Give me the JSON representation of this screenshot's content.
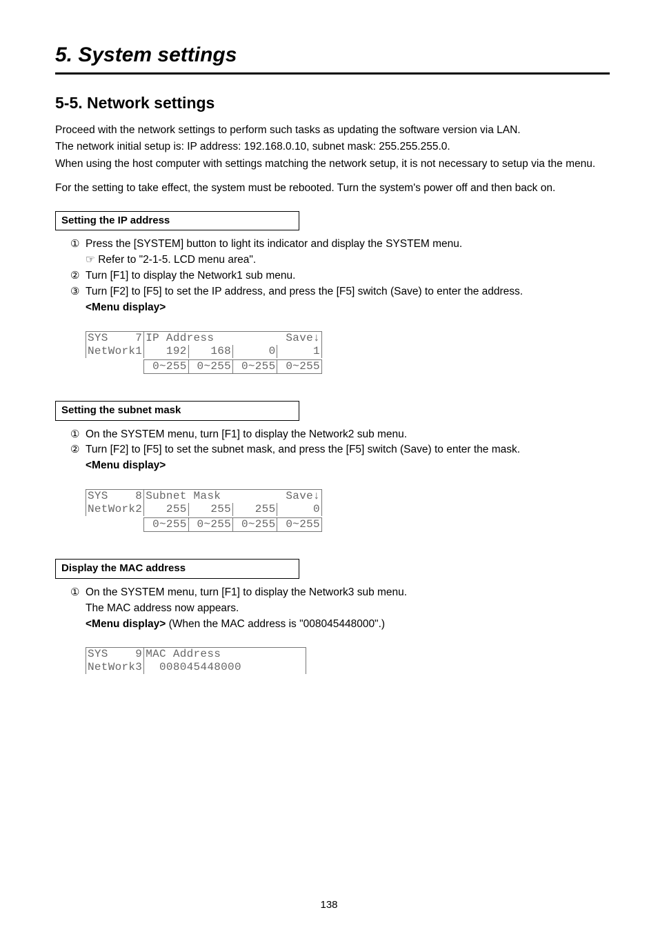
{
  "chapter": {
    "title": "5. System settings"
  },
  "section": {
    "title": "5-5. Network settings"
  },
  "intro": {
    "p1": "Proceed with the network settings to perform such tasks as updating the software version via LAN.",
    "p2": "The network initial setup is: IP address: 192.168.0.10, subnet mask: 255.255.255.0.",
    "p3": "When using the host computer with settings matching the network setup, it is not necessary to setup via the menu.",
    "p4": "For the setting to take effect, the system must be rebooted. Turn the system's power off and then back on."
  },
  "ip": {
    "heading": "Setting the IP address",
    "steps": {
      "s1": "Press the [SYSTEM] button to light its indicator and display the SYSTEM menu.",
      "s1_ref_icon": "☞",
      "s1_ref": " Refer to \"2-1-5. LCD menu area\".",
      "s2": "Turn [F1] to display the Network1 sub menu.",
      "s3": "Turn [F2] to [F5] to set the IP address, and press the [F5] switch (Save) to enter the address."
    },
    "menu_label": "<Menu display>",
    "lcd": {
      "r1c1": "SYS    7",
      "r1c2": "IP Address      ",
      "r1c3": " Save↓",
      "r2c1": "NetWork1",
      "r2c2": "   192",
      "r2c3": "   168",
      "r2c4": "     0",
      "r2c5": "     1",
      "r3c2": " 0~255",
      "r3c3": " 0~255",
      "r3c4": " 0~255",
      "r3c5": " 0~255"
    }
  },
  "subnet": {
    "heading": "Setting the subnet mask",
    "steps": {
      "s1": "On the SYSTEM menu, turn [F1] to display the Network2 sub menu.",
      "s2": "Turn [F2] to [F5] to set the subnet mask, and press the [F5] switch (Save) to enter the mask."
    },
    "menu_label": "<Menu display>",
    "lcd": {
      "r1c1": "SYS    8",
      "r1c2": "Subnet Mask     ",
      "r1c3": " Save↓",
      "r2c1": "NetWork2",
      "r2c2": "   255",
      "r2c3": "   255",
      "r2c4": "   255",
      "r2c5": "     0",
      "r3c2": " 0~255",
      "r3c3": " 0~255",
      "r3c4": " 0~255",
      "r3c5": " 0~255"
    }
  },
  "mac": {
    "heading": "Display the MAC address",
    "steps": {
      "s1": "On the SYSTEM menu, turn [F1] to display the Network3 sub menu.",
      "s1_sub": "The MAC address now appears."
    },
    "menu_label_prefix": "<Menu display>",
    "menu_label_suffix": " (When the MAC address is \"008045448000\".)",
    "lcd": {
      "r1c1": "SYS    9",
      "r1c2": "MAC Address",
      "r2c1": "NetWork3",
      "r2c2": "  008045448000"
    }
  },
  "page_number": "138",
  "circled": {
    "one": "①",
    "two": "②",
    "three": "③"
  }
}
